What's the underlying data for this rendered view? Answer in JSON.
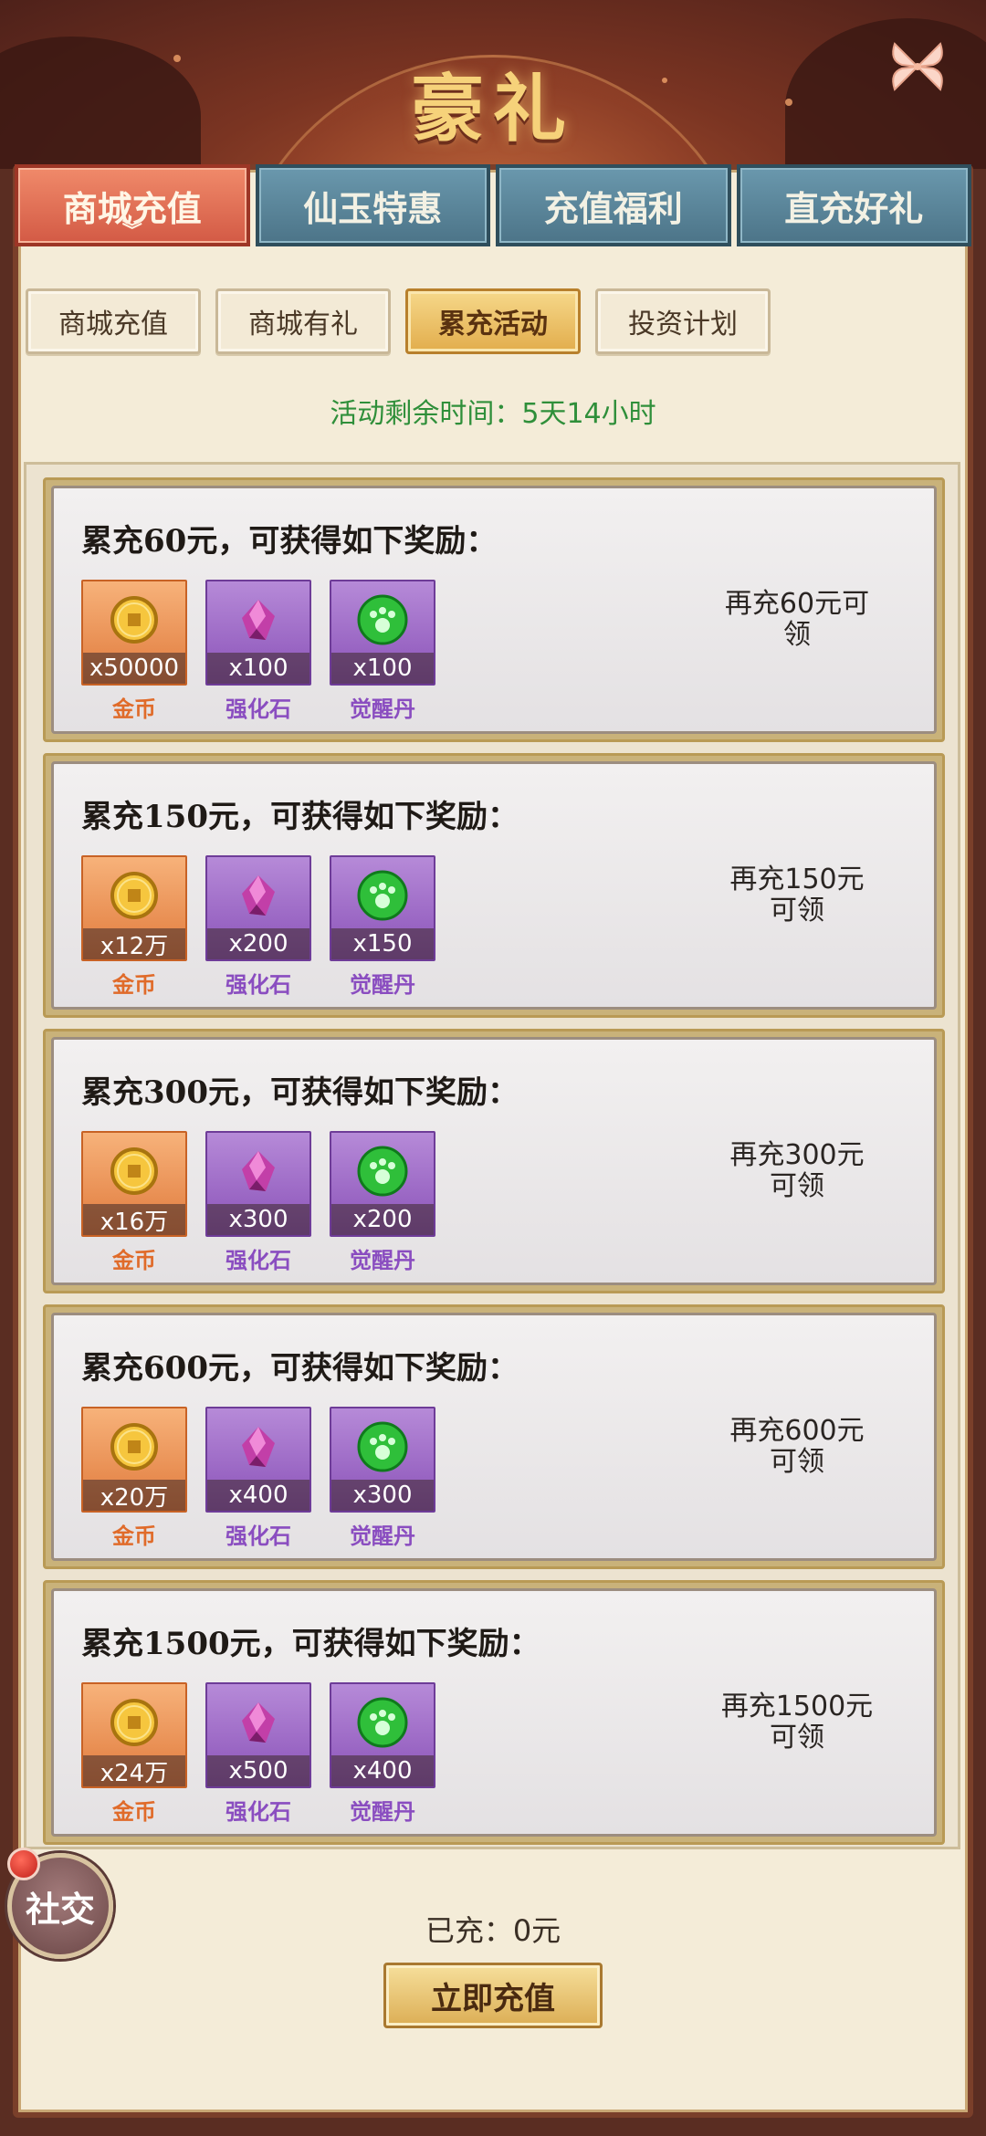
{
  "header": {
    "title": "豪礼"
  },
  "top_tabs": [
    "商城充值",
    "仙玉特惠",
    "充值福利",
    "直充好礼"
  ],
  "sub_tabs": [
    "商城充值",
    "商城有礼",
    "累充活动",
    "投资计划"
  ],
  "timer": "活动剩余时间：5天14小时",
  "cards": [
    {
      "title": "累充60元，可获得如下奖励：",
      "rewards": [
        {
          "qty": "x50000",
          "name": "金币"
        },
        {
          "qty": "x100",
          "name": "强化石"
        },
        {
          "qty": "x100",
          "name": "觉醒丹"
        }
      ],
      "claim_line1": "再充60元可",
      "claim_line2": "领"
    },
    {
      "title": "累充150元，可获得如下奖励：",
      "rewards": [
        {
          "qty": "x12万",
          "name": "金币"
        },
        {
          "qty": "x200",
          "name": "强化石"
        },
        {
          "qty": "x150",
          "name": "觉醒丹"
        }
      ],
      "claim_line1": "再充150元",
      "claim_line2": "可领"
    },
    {
      "title": "累充300元，可获得如下奖励：",
      "rewards": [
        {
          "qty": "x16万",
          "name": "金币"
        },
        {
          "qty": "x300",
          "name": "强化石"
        },
        {
          "qty": "x200",
          "name": "觉醒丹"
        }
      ],
      "claim_line1": "再充300元",
      "claim_line2": "可领"
    },
    {
      "title": "累充600元，可获得如下奖励：",
      "rewards": [
        {
          "qty": "x20万",
          "name": "金币"
        },
        {
          "qty": "x400",
          "name": "强化石"
        },
        {
          "qty": "x300",
          "name": "觉醒丹"
        }
      ],
      "claim_line1": "再充600元",
      "claim_line2": "可领"
    },
    {
      "title": "累充1500元，可获得如下奖励：",
      "rewards": [
        {
          "qty": "x24万",
          "name": "金币"
        },
        {
          "qty": "x500",
          "name": "强化石"
        },
        {
          "qty": "x400",
          "name": "觉醒丹"
        }
      ],
      "claim_line1": "再充1500元",
      "claim_line2": "可领"
    }
  ],
  "footer": {
    "charged": "已充：0元",
    "recharge_button": "立即充值",
    "social": "社交"
  },
  "icons": {
    "close": "butterfly-close-icon",
    "coin": "gold-coin-icon",
    "stone": "purple-gem-icon",
    "pill": "green-paw-orb-icon"
  },
  "colors": {
    "accent_tab": "#d35a45",
    "inactive_tab": "#4c7488",
    "timer": "#2f8f3a",
    "gold_button": "#dcae55"
  }
}
